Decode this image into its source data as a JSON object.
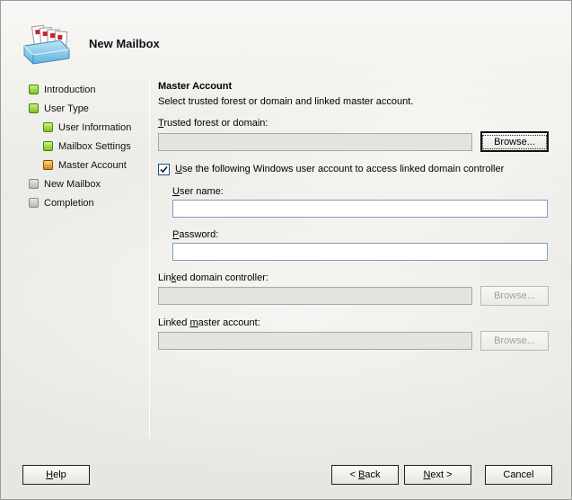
{
  "header": {
    "title": "New Mailbox",
    "icon": "mailbox-wizard-icon"
  },
  "steps": [
    {
      "label": "Introduction",
      "status": "complete"
    },
    {
      "label": "User Type",
      "status": "complete"
    },
    {
      "label": "User Information",
      "status": "complete"
    },
    {
      "label": "Mailbox Settings",
      "status": "complete"
    },
    {
      "label": "Master Account",
      "status": "current"
    },
    {
      "label": "New Mailbox",
      "status": "pending"
    },
    {
      "label": "Completion",
      "status": "pending"
    }
  ],
  "content": {
    "title": "Master Account",
    "description": "Select trusted forest or domain and linked master account.",
    "trusted_forest": {
      "label_prefix": "",
      "label_accel": "T",
      "label_rest": "rusted forest or domain:",
      "value": "",
      "browse_label": "Browse..."
    },
    "use_windows_account": {
      "checked": true,
      "label_accel": "U",
      "label_rest": "se the following Windows user account to access linked domain controller"
    },
    "user_name": {
      "label_accel": "U",
      "label_rest": "ser name:",
      "value": ""
    },
    "password": {
      "label_accel": "P",
      "label_rest": "assword:",
      "value": ""
    },
    "linked_dc": {
      "label_prefix": "Lin",
      "label_accel": "k",
      "label_rest": "ed domain controller:",
      "value": "",
      "browse_label": "Browse..."
    },
    "linked_master": {
      "label_prefix": "Linked ",
      "label_accel": "m",
      "label_rest": "aster account:",
      "value": "",
      "browse_label": "Browse..."
    }
  },
  "footer": {
    "help": {
      "accel": "H",
      "rest": "elp"
    },
    "back": {
      "prefix": "< ",
      "accel": "B",
      "rest": "ack"
    },
    "next": {
      "prefix": "",
      "accel": "N",
      "rest": "ext >"
    },
    "cancel": "Cancel"
  },
  "colors": {
    "complete": "#7dc21e",
    "current": "#d28910",
    "pending": "#b9b9b9",
    "field_border": "#7f9db9"
  }
}
